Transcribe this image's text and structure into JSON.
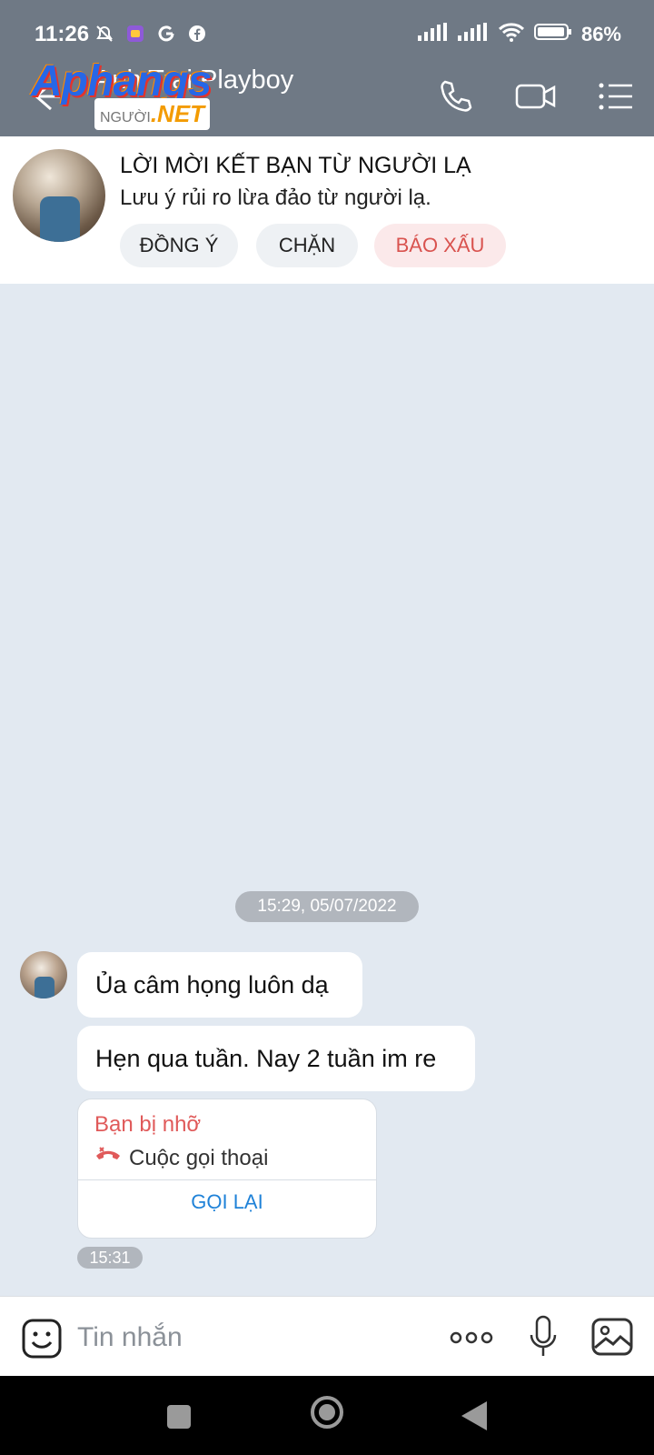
{
  "status_bar": {
    "time": "11:26",
    "battery": "86%"
  },
  "header": {
    "title": "Anh Trai Playboy",
    "watermark_brand": "Aphangs",
    "watermark_domain": ".NET",
    "watermark_prefix": "NGƯỜI"
  },
  "stranger_banner": {
    "title": "LỜI MỜI KẾT BẠN TỪ NGƯỜI LẠ",
    "note": "Lưu ý rủi ro lừa đảo từ người lạ.",
    "agree_label": "ĐỒNG Ý",
    "block_label": "CHẶN",
    "report_label": "BÁO XẤU"
  },
  "chat": {
    "timestamp": "15:29, 05/07/2022",
    "messages": [
      {
        "text": "Ủa câm họng luôn dạ"
      },
      {
        "text": "Hẹn qua tuần. Nay 2 tuần im re"
      }
    ],
    "missed_call": {
      "title": "Bạn bị nhỡ",
      "type": "Cuộc gọi thoại",
      "callback_label": "GỌI LẠI"
    },
    "last_time": "15:31"
  },
  "composer": {
    "placeholder": "Tin nhắn"
  },
  "colors": {
    "header_bg": "#6f7985",
    "chat_bg": "#e2e9f1",
    "report_red": "#d9534f",
    "callback_blue": "#1f82d8"
  }
}
